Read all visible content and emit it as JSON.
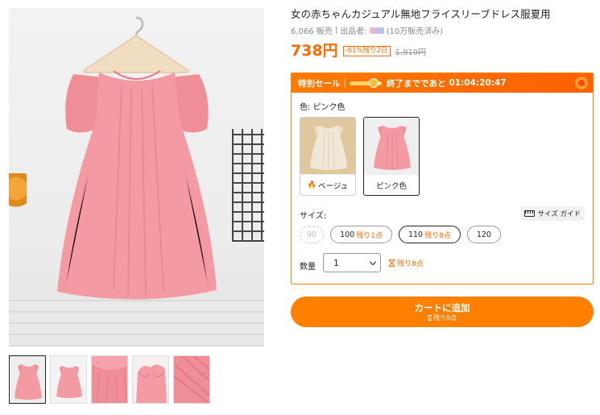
{
  "product": {
    "title": "女の赤ちゃんカジュアル無地フライスリーブドレス服夏用",
    "sold": "6,066 販売",
    "seller_prefix": "出品者:",
    "seller_sold": "(10万販売済み)",
    "price": "738円",
    "discount_badge": "-61%残り2日",
    "original_price": "1,919円"
  },
  "flash_sale": {
    "label": "特別セール",
    "separator": "|",
    "progress": 0.75,
    "countdown_prefix": "終了までであと",
    "countdown": "01:04:20:47"
  },
  "color": {
    "label": "色: ピンク色",
    "options": [
      {
        "name": "ベージュ",
        "hot": true
      },
      {
        "name": "ピンク色",
        "hot": false,
        "selected": true
      }
    ]
  },
  "size": {
    "label": "サイズ:",
    "guide_label": "サイズ ガイド",
    "options": [
      {
        "value": "90",
        "stock": "",
        "disabled": true
      },
      {
        "value": "100",
        "stock": "残り1点"
      },
      {
        "value": "110",
        "stock": "残り8点",
        "selected": true
      },
      {
        "value": "120",
        "stock": ""
      }
    ]
  },
  "quantity": {
    "label": "数量",
    "value": "1",
    "stock": "残り8点"
  },
  "cart": {
    "label": "カートに追加",
    "sub": "残り8点"
  },
  "colors": {
    "accent": "#ff7f00",
    "dress_pink": "#ef8b95",
    "dress_beige": "#efe6d2"
  }
}
